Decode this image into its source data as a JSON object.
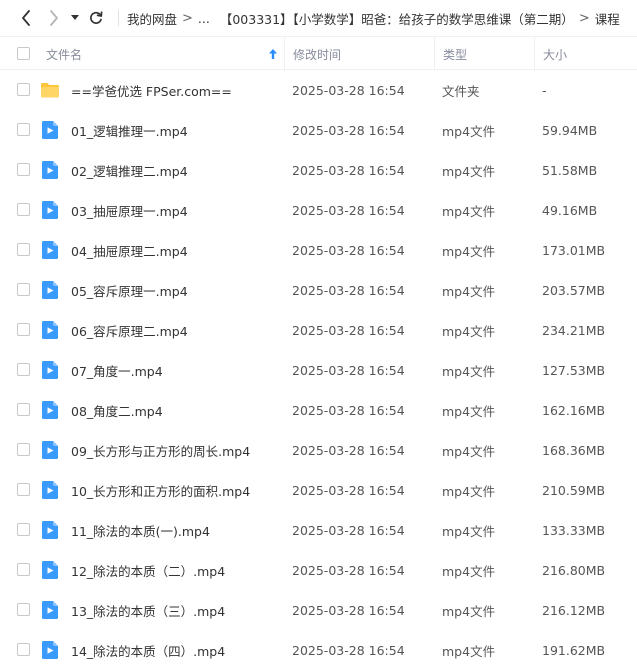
{
  "toolbar": {
    "back_icon": "chevron-left-icon",
    "forward_icon": "chevron-right-icon",
    "dropdown_icon": "caret-down-icon",
    "refresh_icon": "refresh-icon",
    "breadcrumbs": [
      "我的网盘",
      "...",
      "【003331】【小学数学】昭爸：给孩子的数学思维课（第二期）",
      "课程"
    ],
    "separator": ">"
  },
  "table": {
    "headers": {
      "name": "文件名",
      "modified": "修改时间",
      "type": "类型",
      "size": "大小"
    },
    "sort_icon": "sort-up-arrow-icon",
    "accent_color": "#2b8cff",
    "rows": [
      {
        "icon": "folder-icon",
        "name": "==学爸优选 FPSer.com==",
        "modified": "2025-03-28 16:54",
        "type": "文件夹",
        "size": "-"
      },
      {
        "icon": "video-file-icon",
        "name": "01_逻辑推理一.mp4",
        "modified": "2025-03-28 16:54",
        "type": "mp4文件",
        "size": "59.94MB"
      },
      {
        "icon": "video-file-icon",
        "name": "02_逻辑推理二.mp4",
        "modified": "2025-03-28 16:54",
        "type": "mp4文件",
        "size": "51.58MB"
      },
      {
        "icon": "video-file-icon",
        "name": "03_抽屉原理一.mp4",
        "modified": "2025-03-28 16:54",
        "type": "mp4文件",
        "size": "49.16MB"
      },
      {
        "icon": "video-file-icon",
        "name": "04_抽屉原理二.mp4",
        "modified": "2025-03-28 16:54",
        "type": "mp4文件",
        "size": "173.01MB"
      },
      {
        "icon": "video-file-icon",
        "name": "05_容斥原理一.mp4",
        "modified": "2025-03-28 16:54",
        "type": "mp4文件",
        "size": "203.57MB"
      },
      {
        "icon": "video-file-icon",
        "name": "06_容斥原理二.mp4",
        "modified": "2025-03-28 16:54",
        "type": "mp4文件",
        "size": "234.21MB"
      },
      {
        "icon": "video-file-icon",
        "name": "07_角度一.mp4",
        "modified": "2025-03-28 16:54",
        "type": "mp4文件",
        "size": "127.53MB"
      },
      {
        "icon": "video-file-icon",
        "name": "08_角度二.mp4",
        "modified": "2025-03-28 16:54",
        "type": "mp4文件",
        "size": "162.16MB"
      },
      {
        "icon": "video-file-icon",
        "name": "09_长方形与正方形的周长.mp4",
        "modified": "2025-03-28 16:54",
        "type": "mp4文件",
        "size": "168.36MB"
      },
      {
        "icon": "video-file-icon",
        "name": "10_长方形和正方形的面积.mp4",
        "modified": "2025-03-28 16:54",
        "type": "mp4文件",
        "size": "210.59MB"
      },
      {
        "icon": "video-file-icon",
        "name": "11_除法的本质(一).mp4",
        "modified": "2025-03-28 16:54",
        "type": "mp4文件",
        "size": "133.33MB"
      },
      {
        "icon": "video-file-icon",
        "name": "12_除法的本质（二）.mp4",
        "modified": "2025-03-28 16:54",
        "type": "mp4文件",
        "size": "216.80MB"
      },
      {
        "icon": "video-file-icon",
        "name": "13_除法的本质（三）.mp4",
        "modified": "2025-03-28 16:54",
        "type": "mp4文件",
        "size": "216.12MB"
      },
      {
        "icon": "video-file-icon",
        "name": "14_除法的本质（四）.mp4",
        "modified": "2025-03-28 16:54",
        "type": "mp4文件",
        "size": "191.62MB"
      }
    ]
  }
}
